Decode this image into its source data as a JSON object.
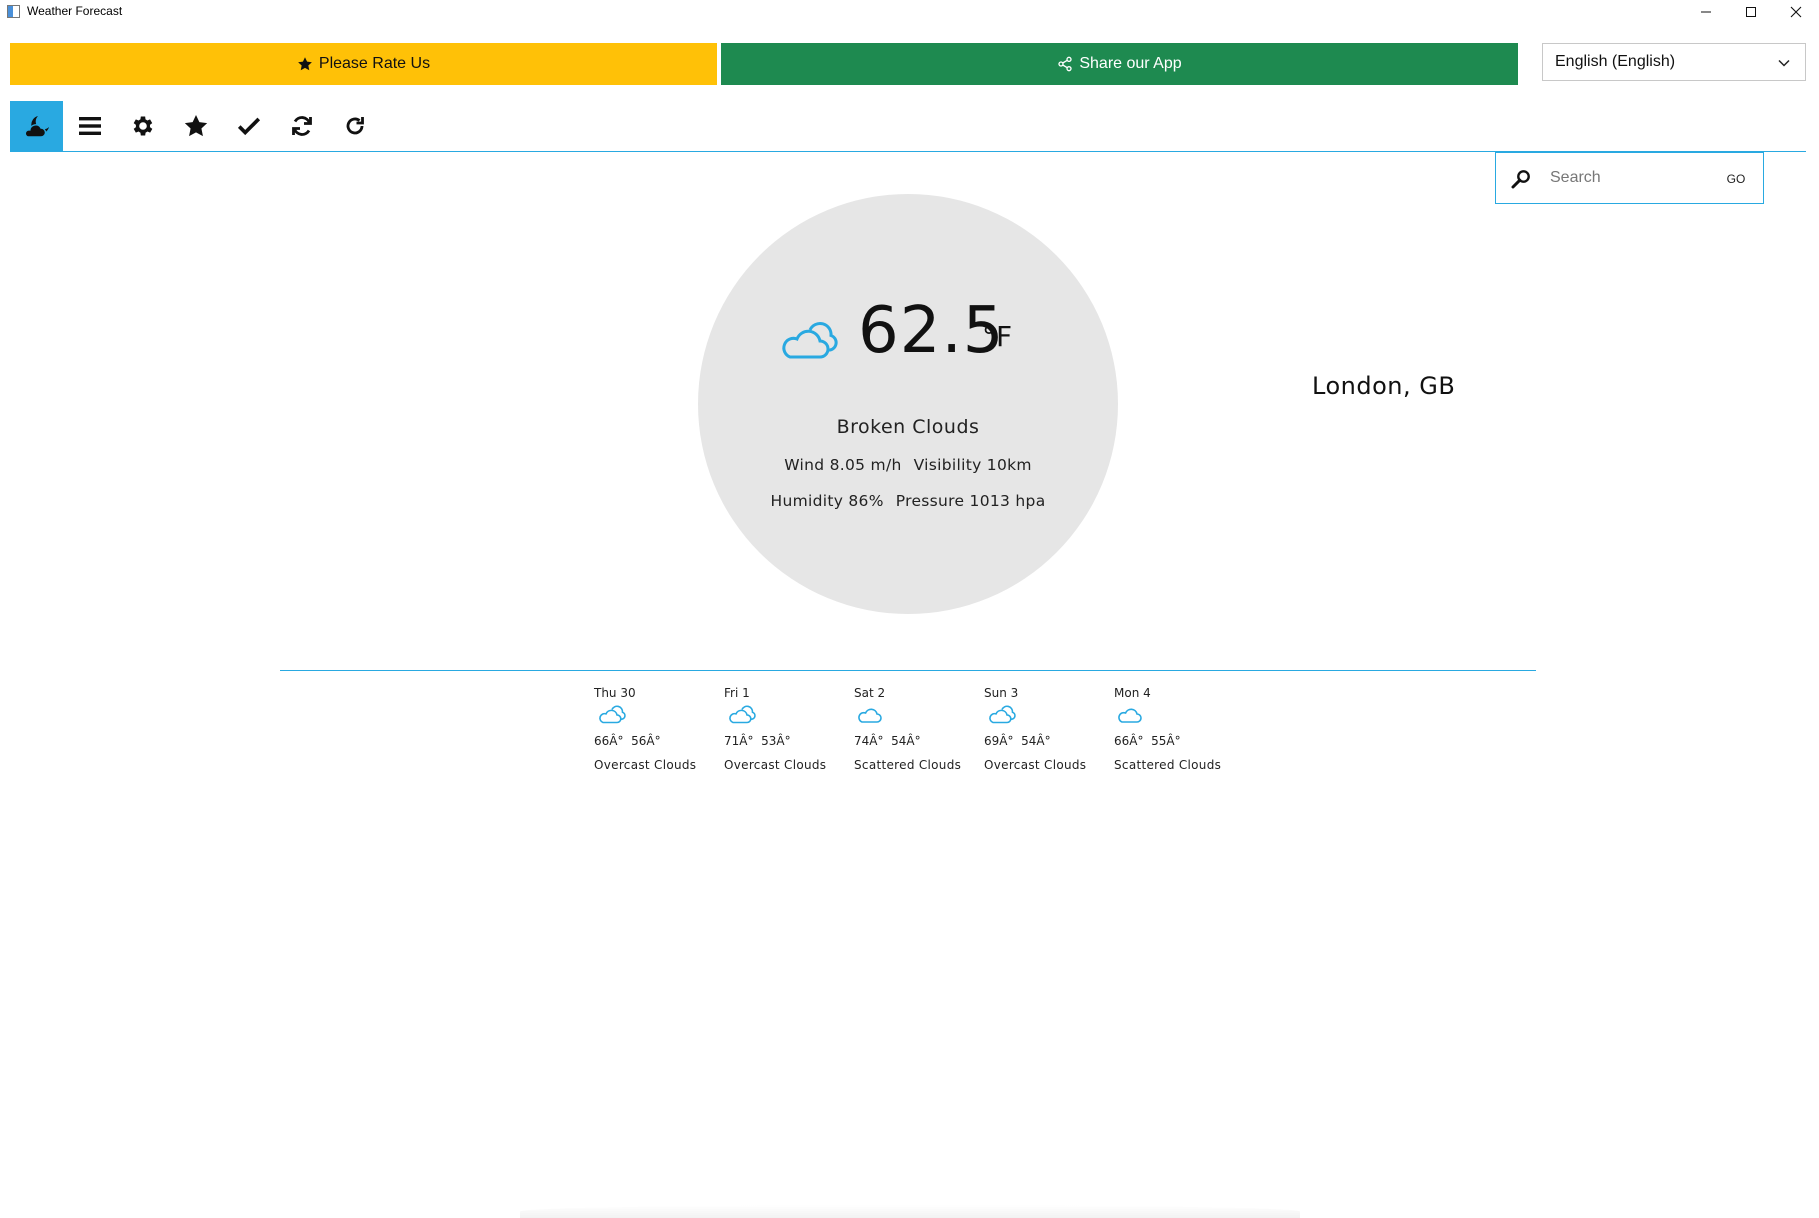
{
  "window": {
    "title": "Weather Forecast",
    "icons": [
      "app-icon",
      "minimize-icon",
      "maximize-icon",
      "close-icon"
    ]
  },
  "actions": {
    "rate_label": "Please Rate Us",
    "share_label": "Share our App",
    "rate_color": "#ffc107",
    "share_color": "#1e8a50"
  },
  "language": {
    "selected": "English (English)"
  },
  "toolbar": {
    "accent": "#29a9e1",
    "items": [
      {
        "icon": "weather-moon-cloud-icon",
        "active": true
      },
      {
        "icon": "menu-icon"
      },
      {
        "icon": "settings-gear-icon"
      },
      {
        "icon": "star-icon"
      },
      {
        "icon": "check-icon"
      },
      {
        "icon": "sync-icon"
      },
      {
        "icon": "refresh-icon"
      }
    ]
  },
  "search": {
    "placeholder": "Search",
    "go_label": "GO"
  },
  "current": {
    "temperature": "62.5",
    "unit": "°F",
    "condition": "Broken Clouds",
    "wind": "Wind 8.05 m/h",
    "visibility": "Visibility 10km",
    "humidity": "Humidity 86%",
    "pressure": "Pressure 1013 hpa",
    "location": "London, GB",
    "icon": "broken-clouds-icon"
  },
  "forecast": [
    {
      "day": "Thu 30",
      "temps": "66Â°  56Â°",
      "desc": "Overcast Clouds",
      "icon": "overcast-clouds-icon"
    },
    {
      "day": "Fri 1",
      "temps": "71Â°  53Â°",
      "desc": "Overcast Clouds",
      "icon": "overcast-clouds-icon"
    },
    {
      "day": "Sat 2",
      "temps": "74Â°  54Â°",
      "desc": "Scattered Clouds",
      "icon": "scattered-clouds-icon"
    },
    {
      "day": "Sun 3",
      "temps": "69Â°  54Â°",
      "desc": "Overcast Clouds",
      "icon": "overcast-clouds-icon"
    },
    {
      "day": "Mon 4",
      "temps": "66Â°  55Â°",
      "desc": "Scattered Clouds",
      "icon": "scattered-clouds-icon"
    }
  ]
}
